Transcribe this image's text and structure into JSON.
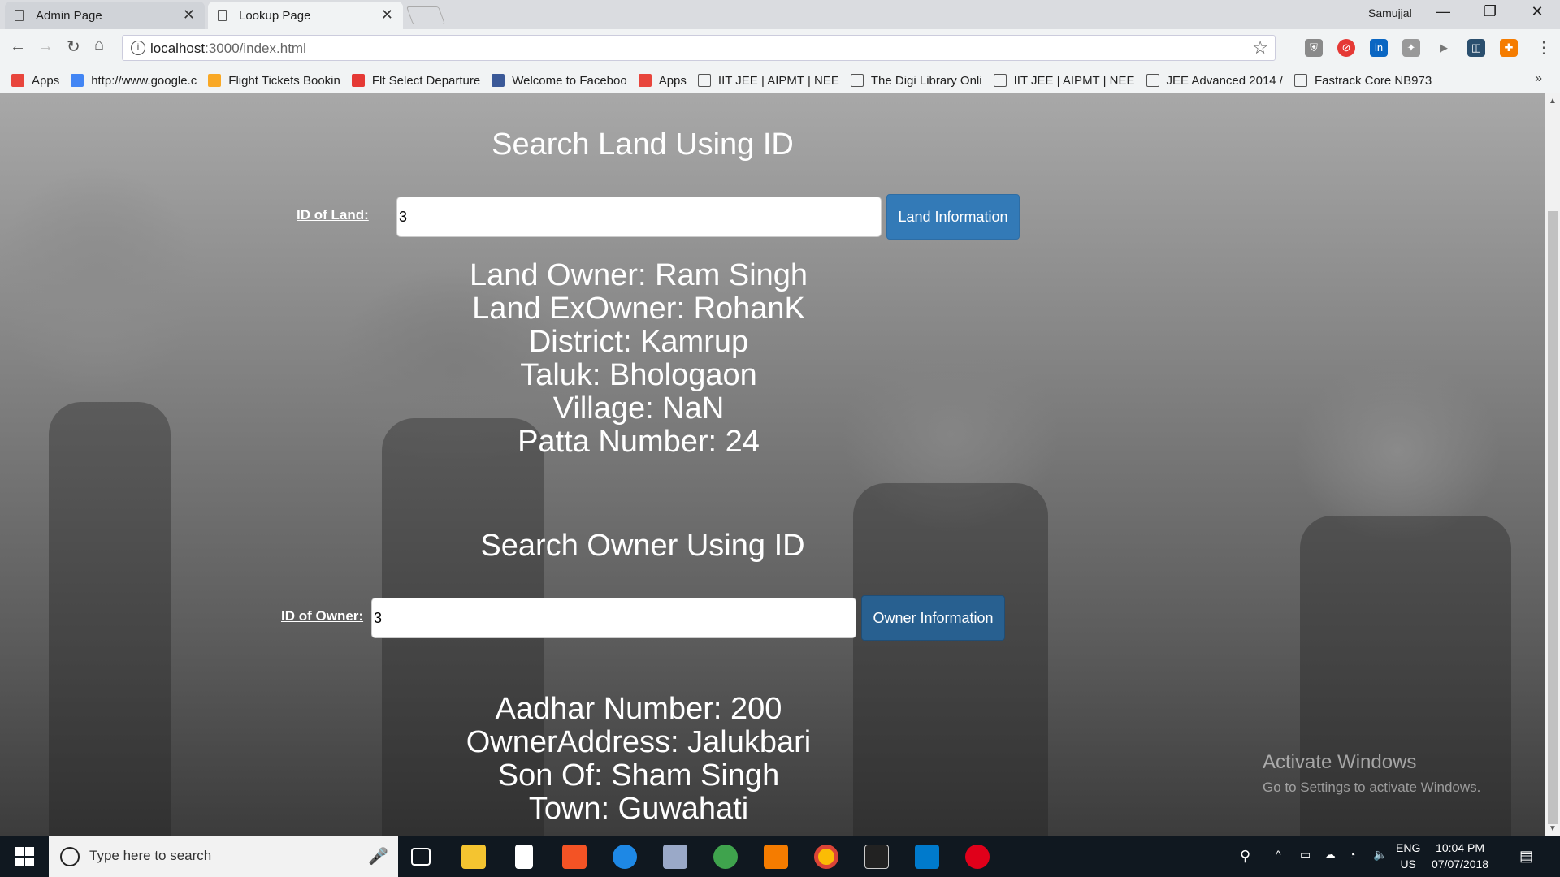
{
  "browser": {
    "tabs": [
      {
        "title": "Admin Page",
        "close": "✕"
      },
      {
        "title": "Lookup Page",
        "close": "✕"
      }
    ],
    "profile": "Samujjal",
    "window_controls": {
      "minimize": "—",
      "restore": "❐",
      "close": "✕"
    },
    "url_host": "localhost",
    "url_rest": ":3000/index.html",
    "bookmarks": [
      {
        "label": "Apps",
        "icon": "apps-grid-icon",
        "color": "#e8453c"
      },
      {
        "label": "http://www.google.c",
        "icon": "google-icon",
        "color": "#4285f4"
      },
      {
        "label": "Flight Tickets Bookin",
        "icon": "flight-icon",
        "color": "#f9a825"
      },
      {
        "label": "Flt Select Departure",
        "icon": "makemytrip-icon",
        "color": "#e53935"
      },
      {
        "label": "Welcome to Faceboo",
        "icon": "facebook-icon",
        "color": "#3b5998"
      },
      {
        "label": "Apps",
        "icon": "apps-grid-icon",
        "color": "#e8453c"
      },
      {
        "label": "IIT JEE | AIPMT | NEE",
        "icon": "page-icon",
        "color": "#ffffff"
      },
      {
        "label": "The Digi Library Onli",
        "icon": "page-icon",
        "color": "#ffffff"
      },
      {
        "label": "IIT JEE | AIPMT | NEE",
        "icon": "page-icon",
        "color": "#ffffff"
      },
      {
        "label": "JEE Advanced 2014 /",
        "icon": "page-icon",
        "color": "#ffffff"
      },
      {
        "label": "Fastrack Core NB973",
        "icon": "page-icon",
        "color": "#ffffff"
      }
    ],
    "bookmarks_more": "»"
  },
  "land": {
    "heading": "Search Land Using ID",
    "label": "ID of Land:",
    "input_value": "3",
    "button": "Land Information",
    "results": [
      "Land Owner: Ram Singh",
      "Land ExOwner: RohanK",
      "District: Kamrup",
      "Taluk: Bhologaon",
      "Village: NaN",
      "Patta Number: 24"
    ]
  },
  "owner": {
    "heading": "Search Owner Using ID",
    "label": "ID of Owner:",
    "input_value": "3",
    "button": "Owner Information",
    "results": [
      "Aadhar Number: 200",
      "OwnerAddress: Jalukbari",
      "Son Of: Sham Singh",
      "Town: Guwahati"
    ]
  },
  "watermark": {
    "line1": "Activate Windows",
    "line2": "Go to Settings to activate Windows."
  },
  "taskbar": {
    "search_placeholder": "Type here to search",
    "language": "ENG",
    "region": "US",
    "time": "10:04 PM",
    "date": "07/07/2018",
    "apps": [
      "task-view",
      "file-explorer",
      "notepad",
      "store",
      "edge",
      "app-generic",
      "atom",
      "sublime-text",
      "chrome",
      "terminal",
      "vscode",
      "opera"
    ],
    "accent": "#101820"
  },
  "colors": {
    "button": "#337ab7",
    "button_active": "#286090"
  }
}
